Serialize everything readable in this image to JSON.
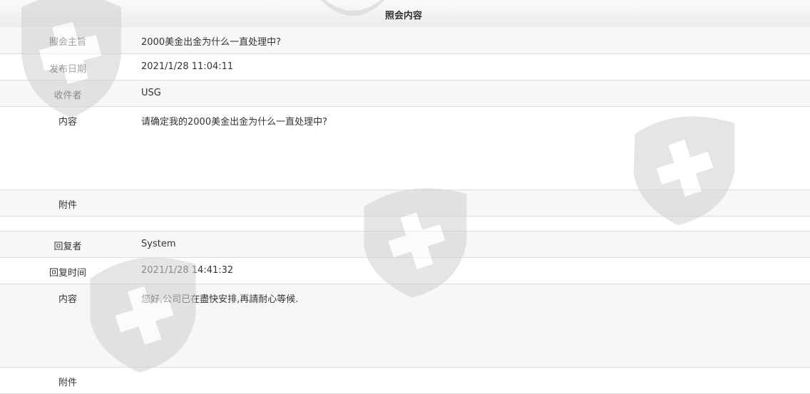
{
  "header": {
    "title": "照会内容"
  },
  "inquiry": {
    "subject_label": "照会主旨",
    "subject_value": "2000美金出金为什么一直处理中?",
    "date_label": "发布日期",
    "date_value": "2021/1/28 11:04:11",
    "recipient_label": "收件者",
    "recipient_value": "USG",
    "content_label": "内容",
    "content_value": "请确定我的2000美金出金为什么一直处理中?",
    "attachment_label": "附件",
    "attachment_value": ""
  },
  "reply": {
    "replier_label": "回复者",
    "replier_value": "System",
    "time_label": "回复时间",
    "time_value": "2021/1/28 14:41:32",
    "content_label": "内容",
    "content_value": "您好,公司已在盡快安排,再請耐心等候.",
    "attachment_label": "附件",
    "attachment_value": ""
  },
  "watermark_icon": "shield-cross-icon",
  "colors": {
    "row_alt": "#f7f7f7",
    "border": "#dddddd",
    "text": "#333333",
    "watermark": "#d9d9d9"
  }
}
